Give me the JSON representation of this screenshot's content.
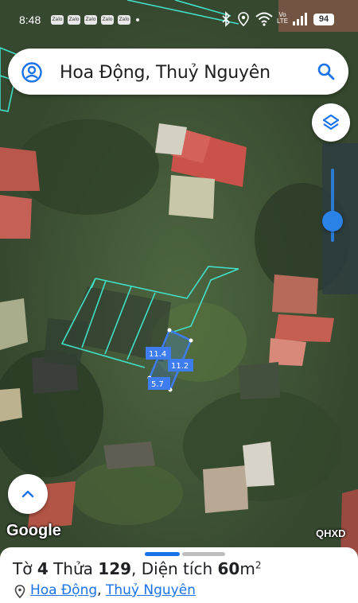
{
  "status_bar": {
    "time": "8:48",
    "notification_icons": [
      "Zalo",
      "Zalo",
      "Zalo",
      "Zalo",
      "Zalo"
    ],
    "icons": [
      "map-pin-icon",
      "bluetooth-icon",
      "location-icon",
      "wifi-icon",
      "volte-icon",
      "signal-icon"
    ],
    "volte_label": "Vo LTE",
    "battery": "94"
  },
  "search": {
    "query": "Hoa Động, Thuỷ Nguyên"
  },
  "map": {
    "attribution": "Google",
    "layer_label": "QHXD",
    "parcel_dimensions": {
      "side_top": "11.4",
      "side_right": "11.2",
      "side_bottom": "5.7"
    },
    "colors": {
      "parcel_outline": "#40e0c8",
      "selected_parcel": "#3d7df0",
      "accent": "#1a73e8"
    }
  },
  "parcel_info": {
    "sheet_label": "Tờ",
    "sheet_number": "4",
    "lot_label": "Thửa",
    "lot_number": "129",
    "area_label": "Diện tích",
    "area_value": "60",
    "area_unit": "m",
    "area_superscript": "2",
    "commune": "Hoa Động",
    "district": "Thuỷ Nguyên"
  }
}
